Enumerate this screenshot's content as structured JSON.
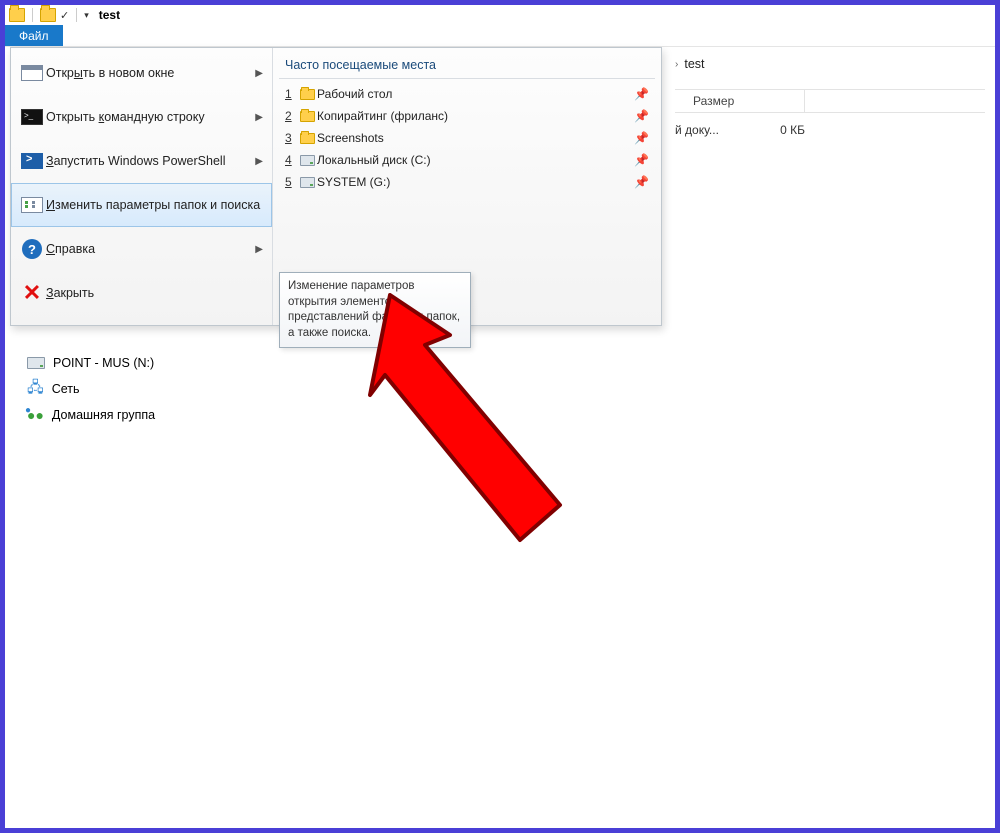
{
  "window": {
    "title": "test"
  },
  "ribbon": {
    "file_tab": "Файл"
  },
  "file_menu": {
    "items": [
      {
        "label_pre": "Откр",
        "accel": "ы",
        "label_post": "ть в новом окне"
      },
      {
        "label_pre": "Открыть ",
        "accel": "к",
        "label_post": "омандную строку"
      },
      {
        "label_pre": "",
        "accel": "З",
        "label_post": "апустить Windows PowerShell"
      },
      {
        "label_pre": "",
        "accel": "И",
        "label_post": "зменить параметры папок и поиска"
      },
      {
        "label_pre": "",
        "accel": "С",
        "label_post": "правка"
      },
      {
        "label_pre": "",
        "accel": "З",
        "label_post": "акрыть"
      }
    ]
  },
  "frequent": {
    "header": "Часто посещаемые места",
    "items": [
      {
        "n": "1",
        "label": "Рабочий стол"
      },
      {
        "n": "2",
        "label": "Копирайтинг (фриланс)"
      },
      {
        "n": "3",
        "label": "Screenshots"
      },
      {
        "n": "4",
        "label": "Локальный диск (C:)"
      },
      {
        "n": "5",
        "label": "SYSTEM (G:)"
      }
    ]
  },
  "tooltip": "Изменение параметров открытия элементов, представлений файлов и папок, а также поиска.",
  "breadcrumb": {
    "current": "test"
  },
  "columns": {
    "size": "Размер"
  },
  "row": {
    "type_partial": "й доку...",
    "size": "0 КБ"
  },
  "sidebar": {
    "drive": "POINT - MUS (N:)",
    "network": "Сеть",
    "homegroup": "Домашняя группа"
  }
}
